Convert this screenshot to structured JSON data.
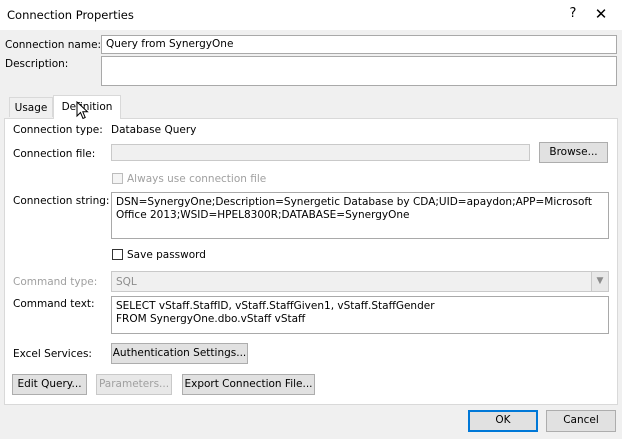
{
  "window": {
    "title": "Connection Properties",
    "help": "?",
    "close": "✕"
  },
  "fields": {
    "connection_name_label": "Connection name:",
    "connection_name_value": "Query from SynergyOne",
    "description_label": "Description:",
    "description_value": ""
  },
  "tabs": [
    {
      "label": "Usage",
      "active": false
    },
    {
      "label": "Definition",
      "active": true
    }
  ],
  "definition": {
    "connection_type_label": "Connection type:",
    "connection_type_value": "Database Query",
    "connection_file_label": "Connection file:",
    "connection_file_value": "",
    "browse_button": "Browse...",
    "always_use_label": "Always use connection file",
    "connection_string_label": "Connection string:",
    "connection_string_value": "DSN=SynergyOne;Description=Synergetic Database by CDA;UID=apaydon;APP=Microsoft Office 2013;WSID=HPEL8300R;DATABASE=SynergyOne",
    "save_password_label": "Save password",
    "command_type_label": "Command type:",
    "command_type_value": "SQL",
    "command_text_label": "Command text:",
    "command_text_line1": "SELECT vStaff.StaffID, vStaff.StaffGiven1, vStaff.StaffGender",
    "command_text_line2": "FROM SynergyOne.dbo.vStaff vStaff",
    "excel_services_label": "Excel Services:",
    "auth_settings_button": "Authentication Settings...",
    "edit_query_button": "Edit Query...",
    "parameters_button": "Parameters...",
    "export_button": "Export Connection File..."
  },
  "footer": {
    "ok_button": "OK",
    "cancel_button": "Cancel"
  }
}
